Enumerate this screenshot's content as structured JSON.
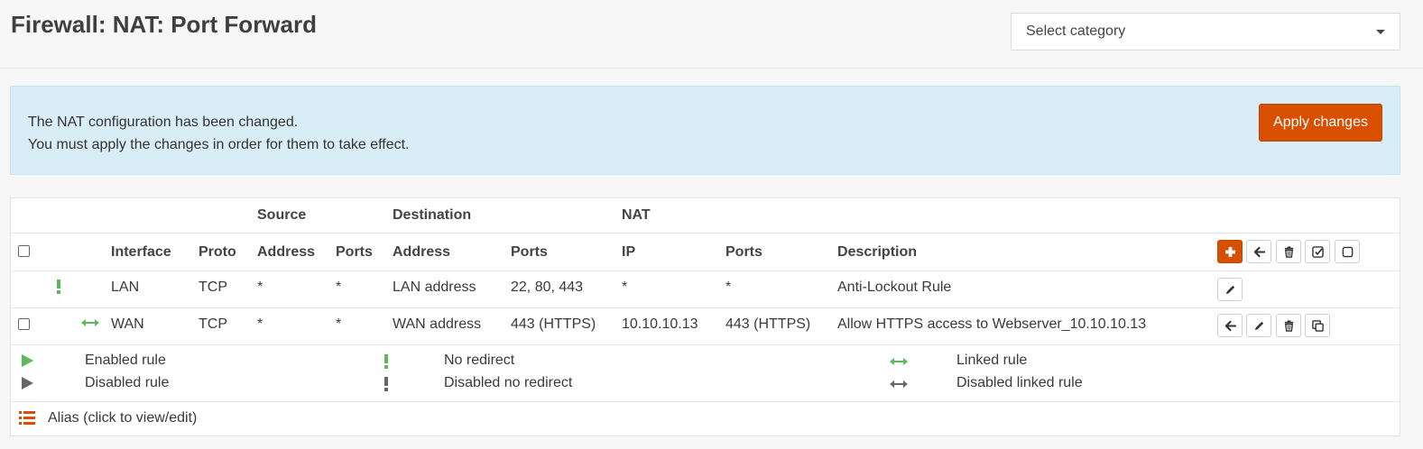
{
  "page": {
    "title": "Firewall: NAT: Port Forward"
  },
  "category_select": {
    "value": "Select category"
  },
  "alert": {
    "line1": "The NAT configuration has been changed.",
    "line2": "You must apply the changes in order for them to take effect.",
    "apply_label": "Apply changes"
  },
  "table": {
    "group_headers": {
      "source": "Source",
      "destination": "Destination",
      "nat": "NAT"
    },
    "columns": {
      "interface": "Interface",
      "proto": "Proto",
      "src_address": "Address",
      "src_ports": "Ports",
      "dst_address": "Address",
      "dst_ports": "Ports",
      "nat_ip": "IP",
      "nat_ports": "Ports",
      "description": "Description"
    },
    "rows": [
      {
        "status_icon": "no-redirect-icon",
        "interface": "LAN",
        "proto": "TCP",
        "src_address": "*",
        "src_ports": "*",
        "dst_address": "LAN address",
        "dst_ports": "22, 80, 443",
        "nat_ip": "*",
        "nat_ports": "*",
        "description": "Anti-Lockout Rule"
      },
      {
        "status_icon": "linked-rule-icon",
        "interface": "WAN",
        "proto": "TCP",
        "src_address": "*",
        "src_ports": "*",
        "dst_address": "WAN address",
        "dst_ports": "443 (HTTPS)",
        "nat_ip": "10.10.10.13",
        "nat_ports": "443 (HTTPS)",
        "description": "Allow HTTPS access to Webserver_10.10.10.13"
      }
    ]
  },
  "legend": {
    "enabled_rule": "Enabled rule",
    "disabled_rule": "Disabled rule",
    "no_redirect": "No redirect",
    "disabled_no_redirect": "Disabled no redirect",
    "linked_rule": "Linked rule",
    "disabled_linked_rule": "Disabled linked rule",
    "alias": "Alias (click to view/edit)"
  },
  "colors": {
    "accent": "#d94f00",
    "alert_bg": "#d9edf7",
    "enabled_green": "#5cb85c",
    "disabled_gray": "#666666"
  }
}
